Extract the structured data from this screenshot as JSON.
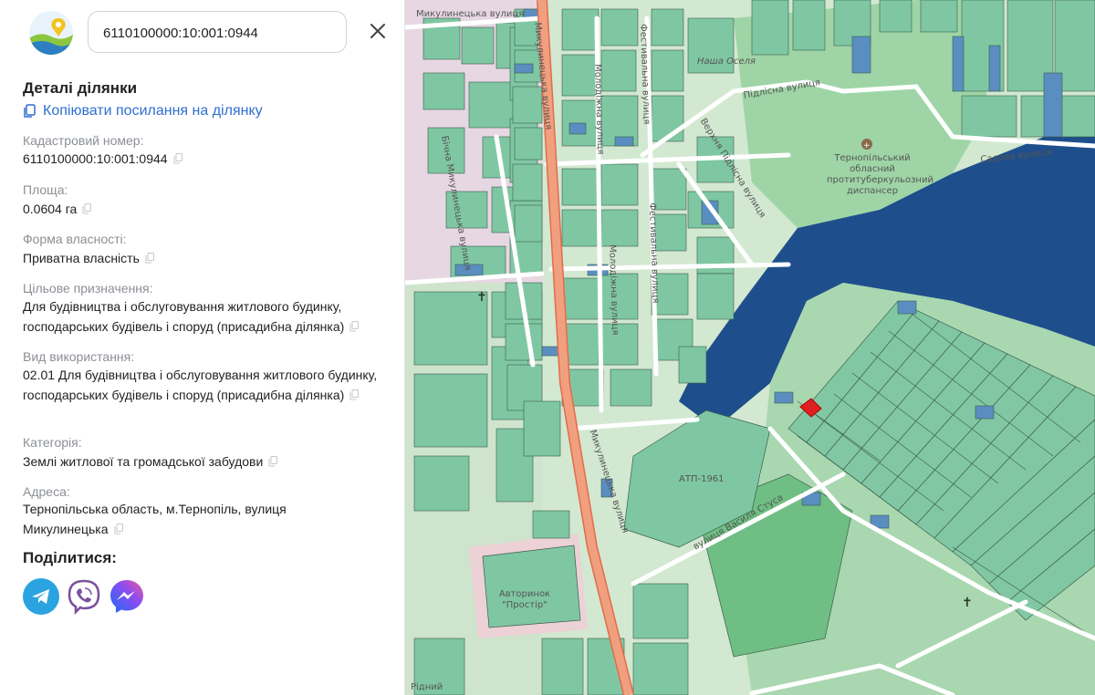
{
  "search": {
    "value": "6110100000:10:001:0944"
  },
  "details": {
    "title": "Деталі ділянки",
    "copy_link_label": "Копіювати посилання на ділянку",
    "fields": [
      {
        "label": "Кадастровий номер:",
        "value": "6110100000:10:001:0944"
      },
      {
        "label": "Площа:",
        "value": "0.0604 га"
      },
      {
        "label": "Форма власності:",
        "value": "Приватна власність"
      },
      {
        "label": "Цільове призначення:",
        "value": "Для будівництва і обслуговування житлового будинку, господарських будівель і споруд (присадибна ділянка)"
      },
      {
        "label": "Вид використання:",
        "value": "02.01 Для будівництва і обслуговування житлового будинку, господарських будівель і споруд (присадибна ділянка)"
      },
      {
        "label": "Категорія:",
        "value": "Землі житлової та громадської забудови"
      },
      {
        "label": "Адреса:",
        "value": "Тернопільська область, м.Тернопіль, вулиця Микулинецька"
      }
    ]
  },
  "share": {
    "title": "Поділитися:",
    "buttons": [
      {
        "name": "telegram",
        "color": "#2aa3e0"
      },
      {
        "name": "viber",
        "color": "#7b519d"
      },
      {
        "name": "messenger",
        "color": "#4a6cf7"
      }
    ]
  },
  "map": {
    "labels": {
      "street_mykulynetska_top": "Микулинецька вулиця",
      "street_mykulynetska_bottom": "Микулинецька вулиця",
      "street_mykulynetska_left": "Микулинецька вулиця",
      "street_bichna": "Бічна Микулинецька вулиця",
      "street_molodizhna_top": "Молодіжна вулиця",
      "street_molodizhna_mid": "Молодіжна вулиця",
      "street_festyvalna_top": "Фестивальна вулиця",
      "street_festyvalna_mid": "Фестивальна вулиця",
      "street_pidlisna": "Підлісна вулиця",
      "street_verkhnia_pidlisna": "Верхня Підлісна вулиця",
      "street_sadova": "Садова вулиця",
      "street_vasylia_stusa": "вулиця Василя Стуса",
      "poi_nasha_oselia": "Наша Оселя",
      "poi_dispanser": "Тернопільський обласний протитуберкульозний диспансер",
      "poi_atp": "АТП-1961",
      "poi_avtorynok": "Авторинок \"Простір\"",
      "poi_ridnyi": "Рідний"
    },
    "colors": {
      "parcel": "#7fc7a3",
      "parcel_alt": "#5a8ec1",
      "road": "#ffffff",
      "main_road": "#f0a07e",
      "water": "#1e4f8c",
      "forest": "#9fd5a6",
      "selected": "#e02020"
    }
  }
}
